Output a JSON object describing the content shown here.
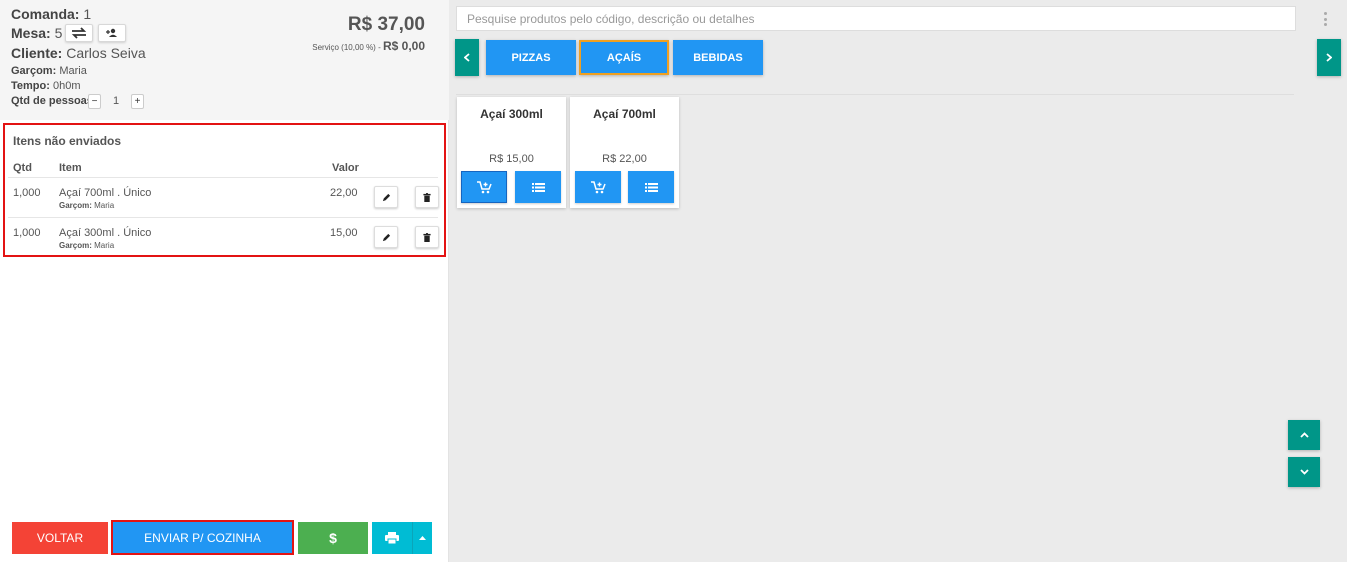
{
  "header": {
    "comanda_label": "Comanda:",
    "comanda_value": "1",
    "mesa_label": "Mesa:",
    "mesa_value": "5",
    "cliente_label": "Cliente:",
    "cliente_value": "Carlos Seiva",
    "garcom_label": "Garçom:",
    "garcom_value": "Maria",
    "tempo_label": "Tempo:",
    "tempo_value": "0h0m",
    "pessoas_label": "Qtd de pessoas:",
    "pessoas_value": "1",
    "minus": "−",
    "plus": "+",
    "total": "R$ 37,00",
    "servico_label": "Serviço (10,00 %)",
    "servico_dash": " - ",
    "servico_value": "R$ 0,00"
  },
  "items": {
    "title": "Itens não enviados",
    "columns": {
      "qtd": "Qtd",
      "item": "Item",
      "valor": "Valor"
    },
    "garcom_label": "Garçom:",
    "rows": [
      {
        "qtd": "1,000",
        "item": "Açaí 700ml . Único",
        "garcom": "Maria",
        "valor": "22,00"
      },
      {
        "qtd": "1,000",
        "item": "Açaí 300ml . Único",
        "garcom": "Maria",
        "valor": "15,00"
      }
    ]
  },
  "footer": {
    "voltar": "VOLTAR",
    "enviar": "ENVIAR P/ COZINHA",
    "pay": "$"
  },
  "search": {
    "placeholder": "Pesquise produtos pelo código, descrição ou detalhes"
  },
  "categories": [
    {
      "label": "PIZZAS"
    },
    {
      "label": "AÇAÍS",
      "active": true
    },
    {
      "label": "BEBIDAS"
    }
  ],
  "products": [
    {
      "name": "Açaí 300ml",
      "price": "R$ 15,00"
    },
    {
      "name": "Açaí 700ml",
      "price": "R$ 22,00"
    }
  ],
  "colors": {
    "primary": "#2196f3",
    "teal": "#009688",
    "danger": "#f44336",
    "success": "#4caf50",
    "cyan": "#00bcd4",
    "highlight_border": "#e31313",
    "active_tab_border": "#f0a020"
  },
  "icons": {
    "swap": "swap-icon",
    "person_add": "person-add-icon",
    "edit": "pencil-icon",
    "delete": "trash-icon",
    "print": "printer-icon",
    "cart": "add-to-cart-icon",
    "list": "list-icon",
    "menu": "kebab-menu-icon"
  }
}
